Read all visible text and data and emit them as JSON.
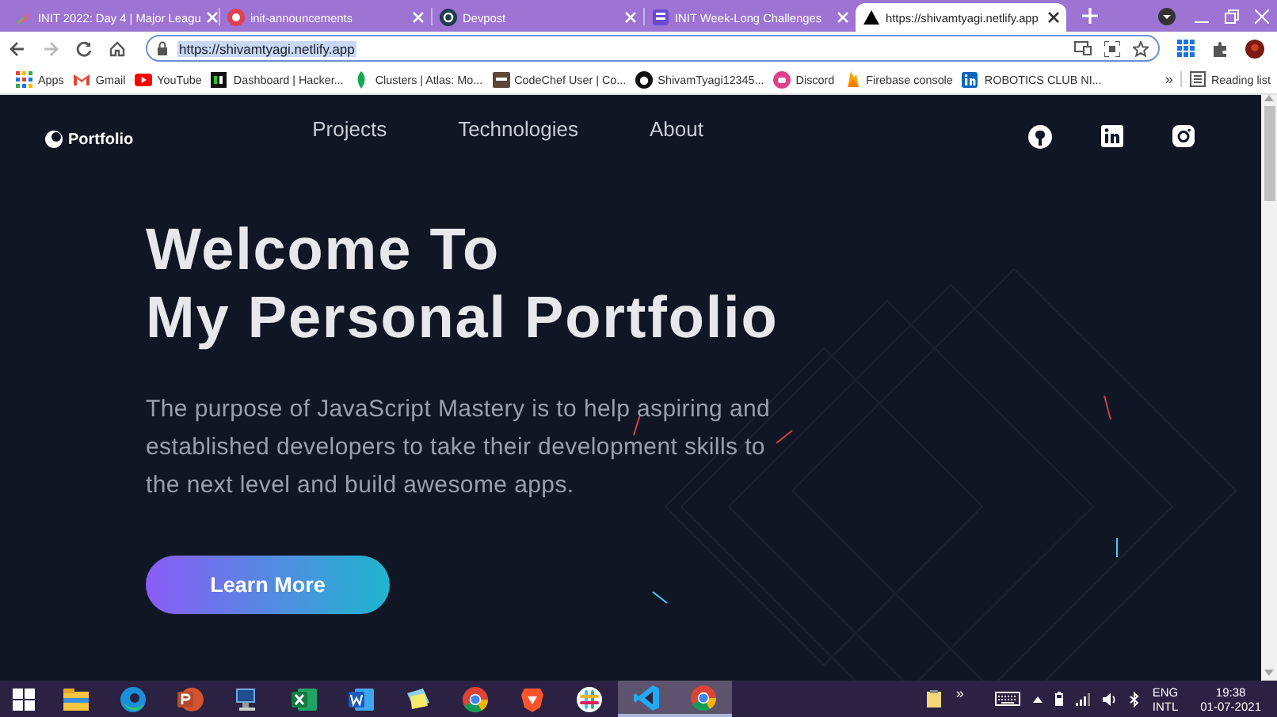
{
  "browser": {
    "tabs": [
      {
        "title": "INIT 2022: Day 4 | Major Leagu",
        "selected": false
      },
      {
        "title": "init-announcements",
        "selected": false
      },
      {
        "title": "Devpost",
        "selected": false
      },
      {
        "title": "INIT Week-Long Challenges",
        "selected": false
      },
      {
        "title": "https://shivamtyagi.netlify.app",
        "selected": true
      }
    ],
    "address": {
      "value": "https://shivamtyagi.netlify.app"
    },
    "bookmarks": [
      "Apps",
      "Gmail",
      "YouTube",
      "Dashboard | Hacker...",
      "Clusters | Atlas: Mo...",
      "CodeChef User | Co...",
      "ShivamTyagi12345...",
      "Discord",
      "Firebase console",
      "ROBOTICS CLUB NI..."
    ],
    "bookmarks_overflow": "»",
    "reading_list": "Reading list"
  },
  "site": {
    "logo": "Portfolio",
    "nav": [
      "Projects",
      "Technologies",
      "About"
    ],
    "heading": [
      "Welcome To",
      "My Personal Portfolio"
    ],
    "intro": "The purpose of JavaScript Mastery is to help aspiring and established developers to take their development skills to the next level and build awesome apps.",
    "cta": "Learn More"
  },
  "taskbar": {
    "apps": [
      {
        "kind": "files",
        "active": false
      },
      {
        "kind": "edge",
        "active": false
      },
      {
        "kind": "powerpoint",
        "active": false
      },
      {
        "kind": "computer",
        "active": false
      },
      {
        "kind": "excel",
        "active": false
      },
      {
        "kind": "word",
        "active": false
      },
      {
        "kind": "notes",
        "active": false
      },
      {
        "kind": "chrome",
        "active": false
      },
      {
        "kind": "brave",
        "active": false
      },
      {
        "kind": "slack",
        "active": false
      },
      {
        "kind": "vscode",
        "active": true
      },
      {
        "kind": "chrome",
        "active": true
      }
    ],
    "tray_overflow": "»",
    "language": "ENG",
    "layout": "INTL",
    "time": "19:38",
    "date": "01-07-2021"
  }
}
